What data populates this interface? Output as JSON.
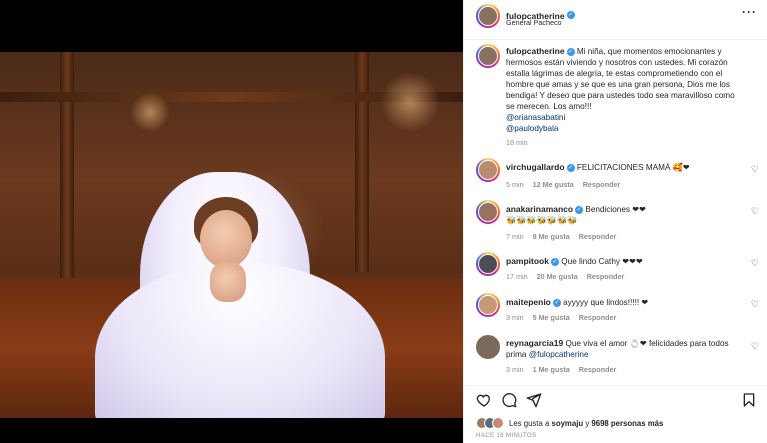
{
  "post": {
    "author": "fulopcatherine",
    "location": "General Pacheco",
    "more_icon": "more-horizontal-icon",
    "caption_author": "fulopcatherine",
    "caption": "Mi niña, que momentos emocionantes y hermosos están viviendo y nosotros con ustedes. Mi corazón estalla lágrimas de alegría, te estas comprometiendo con el hombre que amas y se que es una gran persona, Dios me los bendiga! Y deseo que para ustedes todo sea maravilloso como se merecen. Los amo!!!",
    "mention_1": "@orianasabatini",
    "mention_2": "@paulodybala",
    "caption_time": "18 min"
  },
  "comments": [
    {
      "user": "virchugallardo",
      "text": "FELICITACIONES MAMÁ 🥰❤",
      "time": "5 min",
      "likes": "12 Me gusta",
      "reply": "Responder"
    },
    {
      "user": "anakarinamanco",
      "text": "Bendiciones ❤❤",
      "text2": "🐝🐝🐝🐝🐝🐝🐝",
      "time": "7 min",
      "likes": "8 Me gusta",
      "reply": "Responder"
    },
    {
      "user": "pampitook",
      "text": "Que lindo Cathy ❤❤❤",
      "time": "17 min",
      "likes": "20 Me gusta",
      "reply": "Responder"
    },
    {
      "user": "maitepenio",
      "text": "ayyyyy que lindos!!!!! ❤",
      "time": "3 min",
      "likes": "5 Me gusta",
      "reply": "Responder"
    },
    {
      "user": "reynagarcia19",
      "text": "Que viva el amor 💍❤ felicidades para todos prima",
      "mention": "@fulopcatherine",
      "time": "3 min",
      "likes": "1 Me gusta",
      "reply": "Responder"
    }
  ],
  "footer": {
    "likes_prefix": "Les gusta a",
    "likes_user": "soymaju",
    "likes_joiner": "y",
    "likes_count": "9698 personas más",
    "timestamp": "HACE 18 MINUTOS"
  },
  "icons": {
    "like": "heart-icon",
    "comment": "comment-icon",
    "share": "share-icon",
    "save": "bookmark-icon",
    "verified": "verified-badge-icon"
  },
  "colors": {
    "accent": "#3897f0",
    "heart": "#ed4956",
    "mention": "#00376b",
    "meta": "#8e8e8e"
  }
}
